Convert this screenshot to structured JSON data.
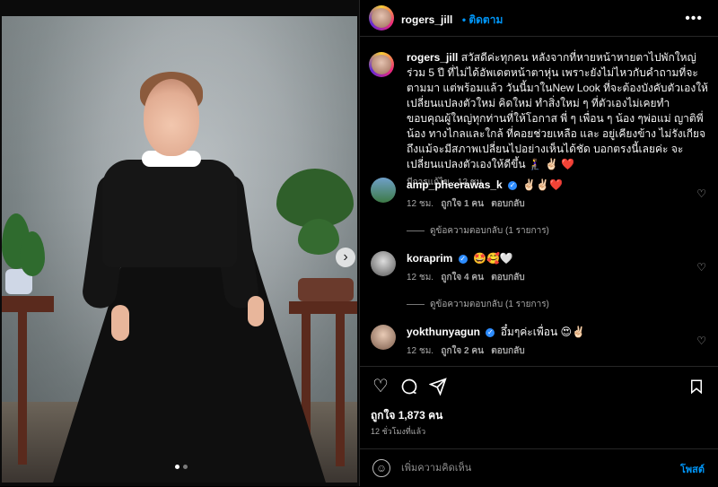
{
  "post": {
    "username": "rogers_jill",
    "follow_label": "• ติดตาม",
    "more_icon": "more-icon",
    "caption": "สวัสดีค่ะทุกคน หลังจากที่หายหน้าหายตาไปพักใหญ่ร่วม 5 ปี ที่ไม่ได้อัพเดตหน้าตาหุ่น เพราะยังไม่ไหวกับคำถามที่จะตามมา แต่พร้อมแล้ว วันนี้มาในNew Look ที่จะต้องบังคับตัวเองให้เปลี่ยนแปลงตัวใหม่ คิดใหม่ ทำสิ่งใหม่ ๆ ที่ตัวเองไม่เคยทำ ขอบคุณผู้ใหญ่ทุกท่านที่ให้โอกาส พี่ ๆ เพื่อน ๆ น้อง ๆพ่อแม่ ญาติพี่น้อง ทางไกลและใกล้ ที่คอยช่วยเหลือ และ อยู่เคียงข้าง ไม่รังเกียจถึงแม้จะมีสภาพเปลี่ยนไปอย่างเห็นได้ชัด บอกตรงนี้เลยค่ะ จะเปลี่ยนแปลงตัวเองให้ดีขึ้น 🧎‍♀️ ✌🏻 ❤️",
    "caption_meta": "มีการแก้ไข · 12 ชม.",
    "likes": "ถูกใจ 1,873 คน",
    "time_ago": "12 ชั่วโมงที่แล้ว"
  },
  "comments": [
    {
      "user": "amp_pheerawas_k",
      "text": "✌🏻✌🏻❤️",
      "meta_time": "12 ชม.",
      "meta_likes": "ถูกใจ 1 คน",
      "reply": "ตอบกลับ",
      "view_replies": "ดูข้อความตอบกลับ (1 รายการ)"
    },
    {
      "user": "koraprim",
      "text": "🤩🥰🤍",
      "meta_time": "12 ชม.",
      "meta_likes": "ถูกใจ 4 คน",
      "reply": "ตอบกลับ",
      "view_replies": "ดูข้อความตอบกลับ (1 รายการ)"
    },
    {
      "user": "yokthunyagun",
      "text": "อึ๋มๆค่ะเพื่อน 😍✌🏻",
      "meta_time": "12 ชม.",
      "meta_likes": "ถูกใจ 2 คน",
      "reply": "ตอบกลับ"
    }
  ],
  "composer": {
    "placeholder": "เพิ่มความคิดเห็น",
    "post_label": "โพสต์"
  },
  "icons": {
    "like": "heart-icon",
    "comment": "comment-icon",
    "share": "share-icon",
    "save": "bookmark-icon",
    "emoji": "emoji-icon",
    "next": "chevron-right-icon"
  },
  "colors": {
    "accent": "#0095f6",
    "background": "#000000",
    "muted": "#a8a8a8"
  },
  "carousel": {
    "active_slide": 1,
    "total_slides": 2
  }
}
